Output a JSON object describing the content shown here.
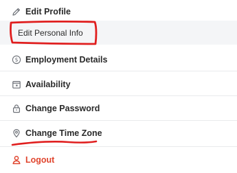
{
  "menu": {
    "items": [
      {
        "label": "Edit Profile",
        "icon": "pencil-icon"
      },
      {
        "label": "Edit Personal Info",
        "icon": null
      },
      {
        "label": "Employment Details",
        "icon": "dollar-circle-icon"
      },
      {
        "label": "Availability",
        "icon": "calendar-icon"
      },
      {
        "label": "Change Password",
        "icon": "lock-icon"
      },
      {
        "label": "Change Time Zone",
        "icon": "location-pin-icon"
      },
      {
        "label": "Logout",
        "icon": "user-icon"
      }
    ]
  },
  "colors": {
    "text": "#2a2a2a",
    "icon": "#6b6f76",
    "logout": "#e0452e",
    "annotation": "#e01e1e",
    "submenu_bg": "#f4f5f7"
  }
}
